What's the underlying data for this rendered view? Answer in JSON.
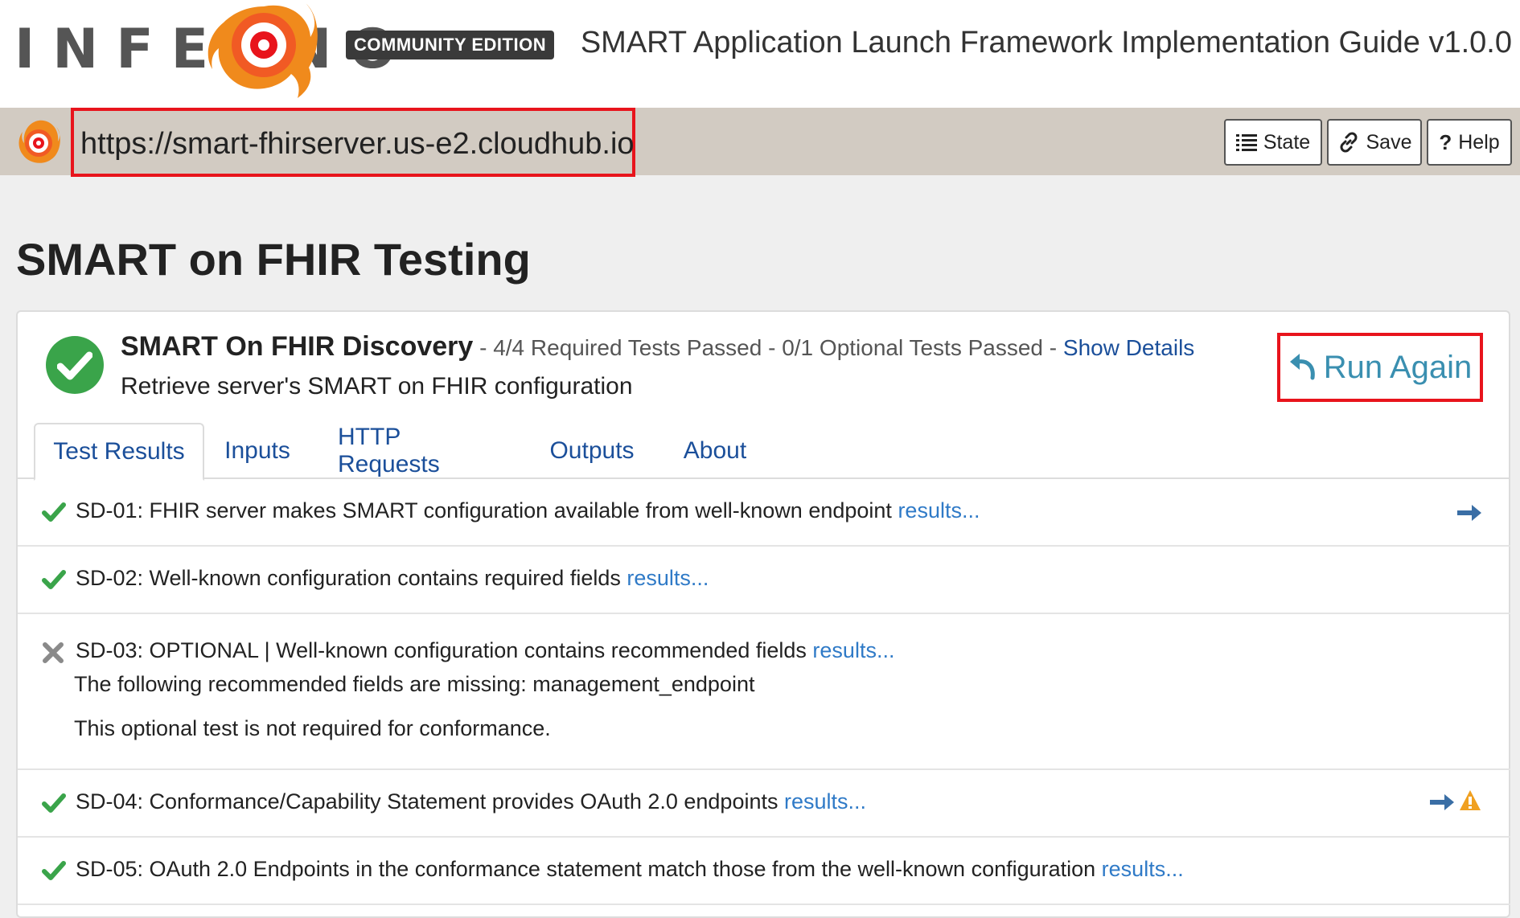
{
  "header": {
    "logo_text": "INFERNO",
    "edition": "COMMUNITY EDITION",
    "guide_title": "SMART Application Launch Framework Implementation Guide v1.0.0",
    "accent_color": "#e8141c"
  },
  "urlbar": {
    "url": "https://smart-fhirserver.us-e2.cloudhub.io",
    "buttons": [
      {
        "label": "State",
        "icon": "list-icon"
      },
      {
        "label": "Save",
        "icon": "link-icon"
      },
      {
        "label": "Help",
        "icon": "question-icon"
      }
    ]
  },
  "page": {
    "title": "SMART on FHIR Testing"
  },
  "suite": {
    "status": "pass",
    "title": "SMART On FHIR Discovery",
    "summary": " - 4/4 Required Tests Passed - 0/1 Optional Tests Passed - ",
    "show_details": "Show Details",
    "description": "Retrieve server's SMART on FHIR configuration",
    "run_again": "Run Again"
  },
  "tabs": [
    {
      "label": "Test Results",
      "active": true
    },
    {
      "label": "Inputs",
      "active": false
    },
    {
      "label": "HTTP Requests",
      "active": false
    },
    {
      "label": "Outputs",
      "active": false
    },
    {
      "label": "About",
      "active": false
    }
  ],
  "tests": [
    {
      "id": "SD-01",
      "text": "SD-01: FHIR server makes SMART configuration available from well-known endpoint ",
      "link": "results...",
      "status": "pass",
      "arrow": true,
      "warning": false
    },
    {
      "id": "SD-02",
      "text": "SD-02: Well-known configuration contains required fields ",
      "link": "results...",
      "status": "pass",
      "arrow": false,
      "warning": false
    },
    {
      "id": "SD-03",
      "text": "SD-03: OPTIONAL | Well-known configuration contains recommended fields ",
      "link": "results...",
      "status": "skip",
      "arrow": false,
      "warning": false,
      "message": "The following recommended fields are missing: management_endpoint",
      "note": "This optional test is not required for conformance."
    },
    {
      "id": "SD-04",
      "text": "SD-04: Conformance/Capability Statement provides OAuth 2.0 endpoints ",
      "link": "results...",
      "status": "pass",
      "arrow": true,
      "warning": true
    },
    {
      "id": "SD-05",
      "text": "SD-05: OAuth 2.0 Endpoints in the conformance statement match those from the well-known configuration ",
      "link": "results...",
      "status": "pass",
      "arrow": false,
      "warning": false
    }
  ]
}
